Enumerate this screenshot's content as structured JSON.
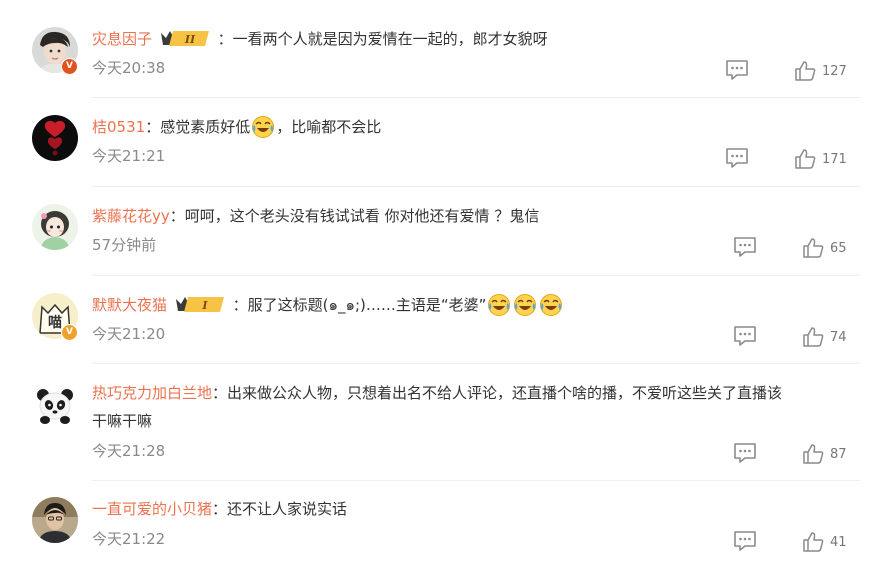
{
  "comments": [
    {
      "username": "灾息因子",
      "separator": "：",
      "segments": [
        "一看两个人就是因为爱情在一起的，郎才女貌呀"
      ],
      "time": "今天20:38",
      "likes": "127",
      "verified": "V",
      "crown_level": "II"
    },
    {
      "username": "桔0531",
      "separator": "：",
      "segments": [
        "感觉素质好低",
        "，比喻都不会比"
      ],
      "time": "今天21:21",
      "likes": "171"
    },
    {
      "username": "紫藤花花yy",
      "separator": "：",
      "segments": [
        "呵呵，这个老头没有钱试试看 你对他还有爱情 ？鬼信"
      ],
      "time": "57分钟前",
      "likes": "65"
    },
    {
      "username": "默默大夜猫",
      "separator": "：",
      "segments": [
        "服了这标题(๑_๑;)……主语是“老婆”"
      ],
      "time": "今天21:20",
      "likes": "74",
      "verified": "V",
      "crown_level": "I"
    },
    {
      "username": "热巧克力加白兰地",
      "separator": "：",
      "segments": [
        "出来做公众人物，只想着出名不给人评论，还直播个啥的播，不爱听这些关了直播该",
        "干嘛干嘛"
      ],
      "time": "今天21:28",
      "likes": "87"
    },
    {
      "username": "一直可爱的小贝猪",
      "separator": "：",
      "segments": [
        "还不让人家说实话"
      ],
      "time": "今天21:22",
      "likes": "41"
    }
  ],
  "icons": {
    "reply": "comment-icon",
    "like": "thumbs-up-icon",
    "emoji": "laughing-crying-emoji",
    "crown": "vip-crown-badge"
  },
  "colors": {
    "username": "#eb7350",
    "text": "#333333",
    "time": "#8a8a8a",
    "icon": "#8a8a8a",
    "verified_red": "#e2521e",
    "verified_orange": "#f0a12c",
    "crown_gold": "#f6c344"
  }
}
